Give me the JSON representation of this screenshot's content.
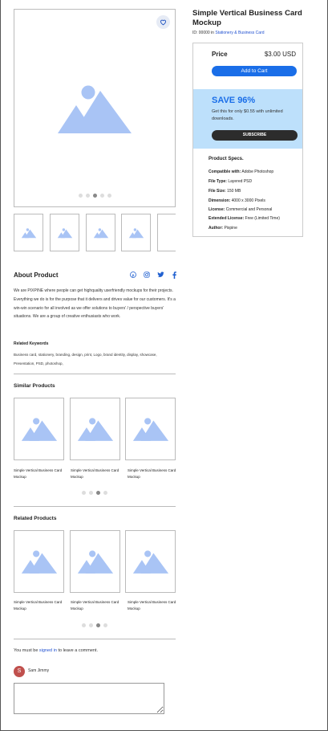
{
  "product": {
    "title": "Simple Vertical Business Card Mockup",
    "id_prefix": "ID: 00000 in ",
    "category_link": "Stationery & Business Card",
    "price_label": "Price",
    "price_value": "$3.00 USD",
    "add_to_cart": "Add to Cart"
  },
  "save": {
    "title": "SAVE 96%",
    "text": "Get this for only $0.55 with unlimited downloads.",
    "subscribe": "SUBSCRIBE"
  },
  "specs": {
    "title": "Product Specs.",
    "items": [
      {
        "label": "Compatible with:",
        "value": "Adobe Photoshop"
      },
      {
        "label": "File Type:",
        "value": "Layered PSD"
      },
      {
        "label": "File Size:",
        "value": "150 MB"
      },
      {
        "label": "Dimension:",
        "value": "4000 x 3000 Pixels"
      },
      {
        "label": "License:",
        "value": "Commercial and Personal"
      },
      {
        "label": "Extended License:",
        "value": "Free (Limited Time)"
      },
      {
        "label": "Author:",
        "value": "Pixpine"
      }
    ]
  },
  "gallery": {
    "active_dot": 3,
    "dot_count": 5,
    "thumb_count": 5
  },
  "about": {
    "title": "About Product",
    "text": "We are PIXPINE where people can get highquality userfriendly mockups for their projects. Everything we do is for the purpose that it delivers and drives value for our customers. It's a win-win scenario for all involved as we offer solutions to buyers' / perspective buyers' situations. We are a group of creative enthusiasts who work.",
    "keywords_title": "Related Keywords",
    "keywords": "Business card, stationery, branding, design, print, Logo, brand identity, display, showcase, Presentation, PSD, photoshop,",
    "social_icons": [
      "pinterest-icon",
      "instagram-icon",
      "twitter-icon",
      "facebook-icon"
    ]
  },
  "similar": {
    "title": "Similar Products",
    "items": [
      {
        "caption": "Simple Vertical Business Card Mockup"
      },
      {
        "caption": "Simple Vertical Business Card Mockup"
      },
      {
        "caption": "Simple Vertical Business Card Mockup"
      }
    ],
    "active_dot": 3
  },
  "related": {
    "title": "Related Products",
    "items": [
      {
        "caption": "Simple Vertical Business Card Mockup"
      },
      {
        "caption": "Simple Vertical Business Card Mockup"
      },
      {
        "caption": "Simple Vertical Business Card Mockup"
      }
    ],
    "active_dot": 3
  },
  "comments": {
    "prefix": "You must be ",
    "link": "signed in",
    "suffix": " to leave a comment.",
    "avatar_letter": "S",
    "user_name": "Sam Jimmy"
  },
  "colors": {
    "accent": "#1a6ee8",
    "placeholder": "#a9c4f5",
    "save_band": "#bde0fb"
  }
}
